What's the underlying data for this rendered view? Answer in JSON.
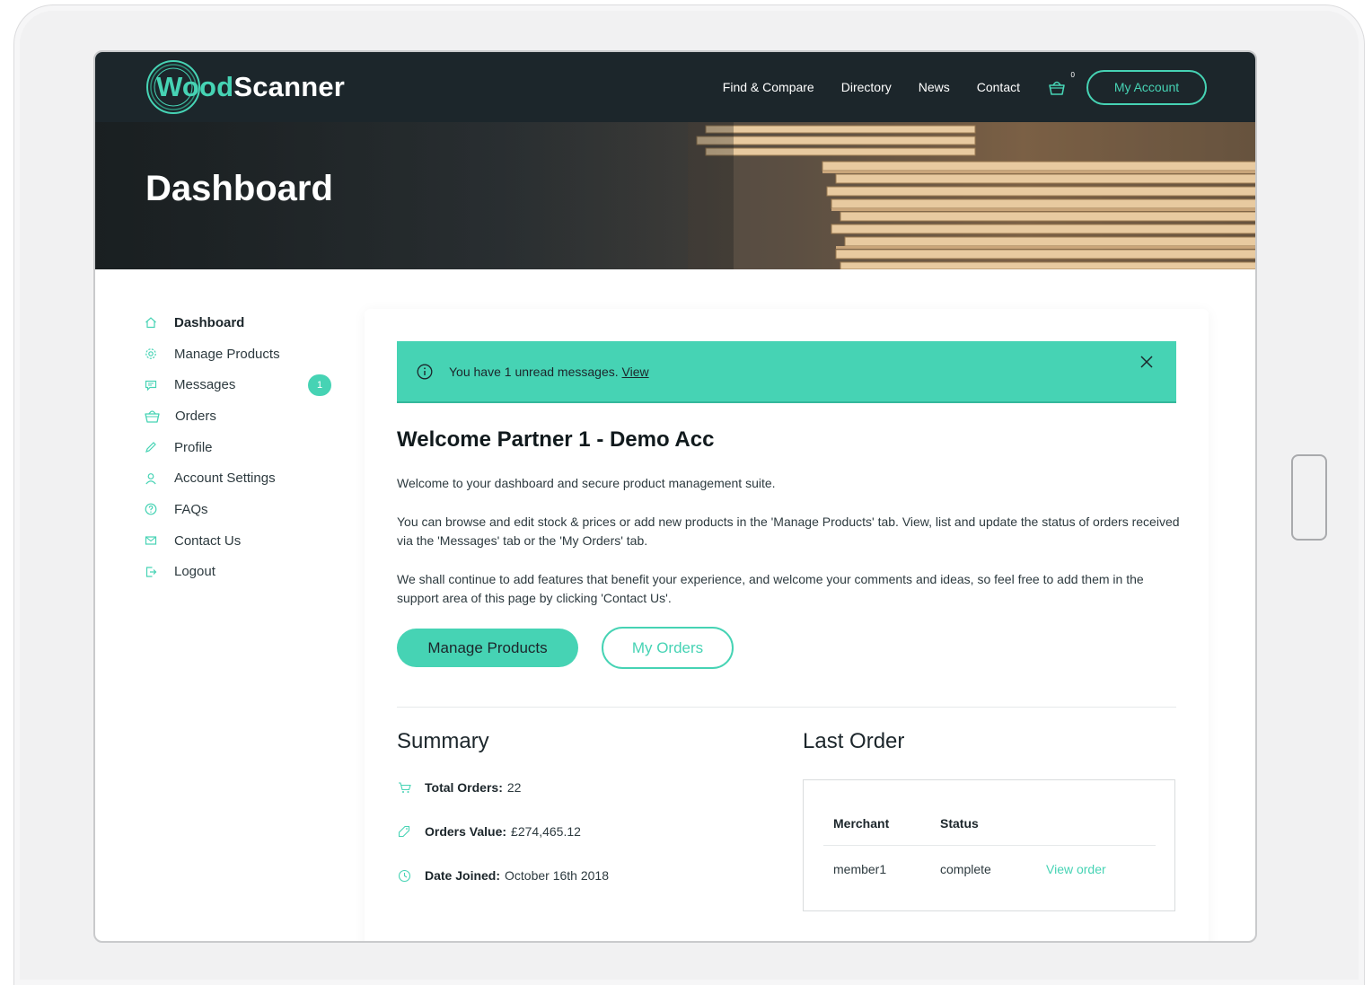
{
  "brand": {
    "name_part1": "Wood",
    "name_part2": "Scanner",
    "accent": "#46d3b4",
    "header_bg": "#1c262b"
  },
  "nav": {
    "items": [
      "Find & Compare",
      "Directory",
      "News",
      "Contact"
    ],
    "cart_count": "0",
    "account_label": "My Account"
  },
  "hero": {
    "title": "Dashboard"
  },
  "sidebar": {
    "items": [
      {
        "label": "Dashboard",
        "icon": "home-icon",
        "active": true
      },
      {
        "label": "Manage Products",
        "icon": "gear-icon"
      },
      {
        "label": "Messages",
        "icon": "message-icon",
        "badge": "1"
      },
      {
        "label": "Orders",
        "icon": "basket-icon"
      },
      {
        "label": "Profile",
        "icon": "pencil-icon"
      },
      {
        "label": "Account Settings",
        "icon": "user-icon"
      },
      {
        "label": "FAQs",
        "icon": "question-icon"
      },
      {
        "label": "Contact Us",
        "icon": "envelope-icon"
      },
      {
        "label": "Logout",
        "icon": "logout-icon"
      }
    ]
  },
  "alert": {
    "text": "You have 1 unread messages. ",
    "link": "View"
  },
  "welcome": {
    "title": "Welcome Partner 1 - Demo Acc",
    "p1": "Welcome to your dashboard and secure product management suite.",
    "p2": "You can browse and edit stock & prices or add new products in the 'Manage Products' tab. View, list and update the status of orders received via the 'Messages' tab or the 'My Orders' tab.",
    "p3": "We shall continue to add features that benefit your experience, and welcome your comments and ideas, so feel free to add them in the support area of this page by clicking 'Contact Us'."
  },
  "buttons": {
    "manage_products": "Manage Products",
    "my_orders": "My Orders"
  },
  "summary": {
    "title": "Summary",
    "total_orders_label": "Total Orders:",
    "total_orders_value": "22",
    "orders_value_label": "Orders Value:",
    "orders_value_value": "£274,465.12",
    "date_joined_label": "Date Joined:",
    "date_joined_value": "October 16th 2018"
  },
  "last_order": {
    "title": "Last Order",
    "col_merchant": "Merchant",
    "col_status": "Status",
    "merchant": "member1",
    "status": "complete",
    "link": "View order"
  }
}
